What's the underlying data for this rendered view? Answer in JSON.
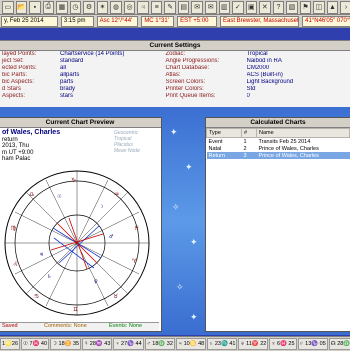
{
  "toolbar": {
    "icons": [
      "file-icon",
      "open-icon",
      "save-icon",
      "print-icon",
      "calendar-icon",
      "clock-icon",
      "settings-icon",
      "star-icon",
      "chart-icon",
      "wheel-icon",
      "planet-icon",
      "list-icon",
      "edit-icon",
      "grid-icon",
      "email-icon",
      "mail-icon",
      "book-icon",
      "check-icon",
      "save-2-icon",
      "close-icon",
      "help-icon",
      "calendar-31-icon",
      "flag-icon",
      "map-icon",
      "up-icon",
      "chevron-icon"
    ]
  },
  "infobar": {
    "date": "y, Feb 25 2014",
    "time": "3:15 pm",
    "asc": "Asc 12°/°44'",
    "mc": "MC 1°31'",
    "zone": "EST +5:00",
    "place": "East Brewster, Massachusetts",
    "coords": "41°N46'05\" 070°W"
  },
  "settings": {
    "title": "Current Settings",
    "left": [
      {
        "label": "layed Points:",
        "value": "Chartservice (14 Points)"
      },
      {
        "label": "ject Set:",
        "value": "standard"
      },
      {
        "label": "ected Points:",
        "value": "all"
      },
      {
        "label": "bic Parts:",
        "value": "allparts"
      },
      {
        "label": "bic Aspects:",
        "value": "parts"
      },
      {
        "label": "d Stars",
        "value": "brady"
      },
      {
        "label": "Aspects:",
        "value": "stars"
      }
    ],
    "right": [
      {
        "label": "Zodiac:",
        "value": "Tropical"
      },
      {
        "label": "Angle Progressions:",
        "value": "Naibod in RA"
      },
      {
        "label": "Chart Database:",
        "value": "CM2000"
      },
      {
        "label": "Atlas:",
        "value": "ACS  (Built-in)"
      },
      {
        "label": "Screen Colors:",
        "value": "Light Background"
      },
      {
        "label": "Printer Colors:",
        "value": "Std"
      },
      {
        "label": "Print Queue Items:",
        "value": "0"
      }
    ]
  },
  "preview": {
    "title": "Current Chart Preview",
    "name": "of Wales, Charles",
    "line2": "return",
    "line3": "2013, Thu",
    "line4": "m  UT +9:00",
    "line5": "ham Palac",
    "watermark_1": "Geocentric",
    "watermark_2": "Tropical",
    "watermark_3": "Placidus",
    "watermark_4": "Mean Node",
    "footer_saved": "Saved",
    "footer_comments": "Comments: None",
    "footer_events": "Events: None"
  },
  "calc": {
    "title": "Calculated Charts",
    "headers": [
      "Type",
      "#",
      "Name"
    ],
    "rows": [
      {
        "type": "Event",
        "num": "1",
        "name": "Transits Feb 25 2014"
      },
      {
        "type": "Natal",
        "num": "2",
        "name": "Prince of Wales, Charles"
      },
      {
        "type": "Return",
        "num": "3",
        "name": "Prince of Wales, Charles"
      }
    ]
  },
  "statusbar": {
    "items": [
      "1♌26",
      "☉ 7♓ 40",
      "☽ 18♊ 35",
      "☿ 28♒ 43",
      "♀ 27♑ 44",
      "♂ 18♎ 32",
      "♃ 10♋ 48",
      "♄ 23♏ 41",
      "♅ 11♈ 22",
      "♆ 6♓ 25",
      "♇ 13♑ 05",
      "☊ 28♎"
    ]
  }
}
